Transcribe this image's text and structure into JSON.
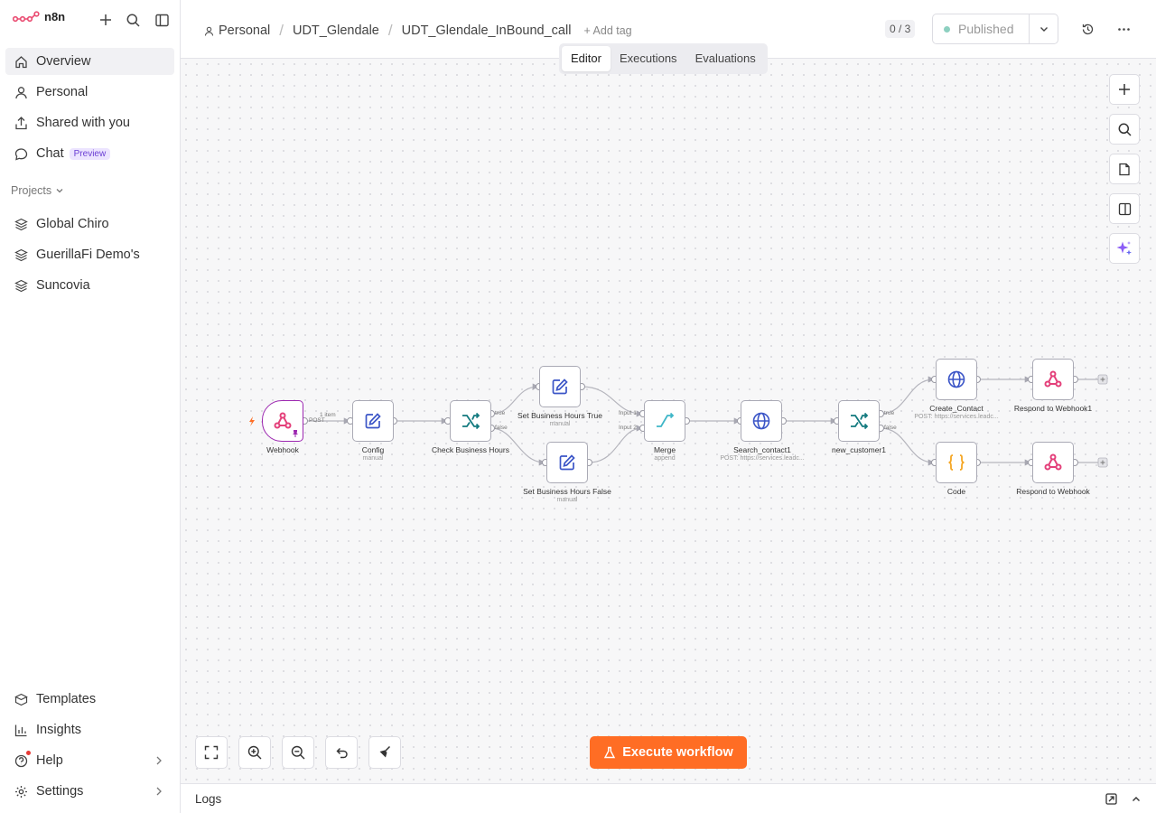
{
  "app": {
    "name": "n8n"
  },
  "sidebar": {
    "nav": [
      {
        "label": "Overview",
        "icon": "home-icon"
      },
      {
        "label": "Personal",
        "icon": "user-icon"
      },
      {
        "label": "Shared with you",
        "icon": "share-icon"
      },
      {
        "label": "Chat",
        "icon": "chat-icon",
        "badge": "Preview"
      }
    ],
    "projects_heading": "Projects",
    "projects": [
      {
        "label": "Global Chiro"
      },
      {
        "label": "GuerillaFi Demo's"
      },
      {
        "label": "Suncovia"
      }
    ],
    "bottom": [
      {
        "label": "Templates"
      },
      {
        "label": "Insights"
      },
      {
        "label": "Help"
      },
      {
        "label": "Settings"
      }
    ]
  },
  "header": {
    "breadcrumbs": [
      "Personal",
      "UDT_Glendale",
      "UDT_Glendale_InBound_call"
    ],
    "add_tag": "+ Add tag",
    "tabs": [
      "Editor",
      "Executions",
      "Evaluations"
    ],
    "active_tab": "Editor",
    "counter": "0 / 3",
    "publish_label": "Published"
  },
  "workflow": {
    "nodes": {
      "webhook": {
        "label": "Webhook"
      },
      "config": {
        "label": "Config",
        "sub": "manual"
      },
      "check": {
        "label": "Check Business Hours"
      },
      "set_true": {
        "label": "Set Business Hours True",
        "sub": "manual"
      },
      "set_false": {
        "label": "Set Business Hours False",
        "sub": "manual"
      },
      "merge": {
        "label": "Merge",
        "sub": "append"
      },
      "search": {
        "label": "Search_contact1",
        "sub": "POST: https://services.leadc..."
      },
      "newcust": {
        "label": "new_customer1"
      },
      "create": {
        "label": "Create_Contact",
        "sub": "POST: https://services.leadc..."
      },
      "code": {
        "label": "Code"
      },
      "respond1": {
        "label": "Respond to Webhook1"
      },
      "respond": {
        "label": "Respond to Webhook"
      }
    },
    "edge_labels": {
      "webhook_method": "POST",
      "item_count": "1 item",
      "true": "true",
      "false": "false",
      "input1": "Input 1",
      "input2": "Input 2"
    }
  },
  "execute_label": "Execute workflow",
  "logs_label": "Logs",
  "colors": {
    "accent": "#ff6d24",
    "trigger": "#9c27b0",
    "webhook_icon": "#e4407a",
    "edit_icon": "#3b55c7",
    "if_icon": "#137a7f",
    "merge_icon": "#3fb6c8",
    "http_icon": "#3b55c7",
    "code_icon": "#f5a623"
  }
}
